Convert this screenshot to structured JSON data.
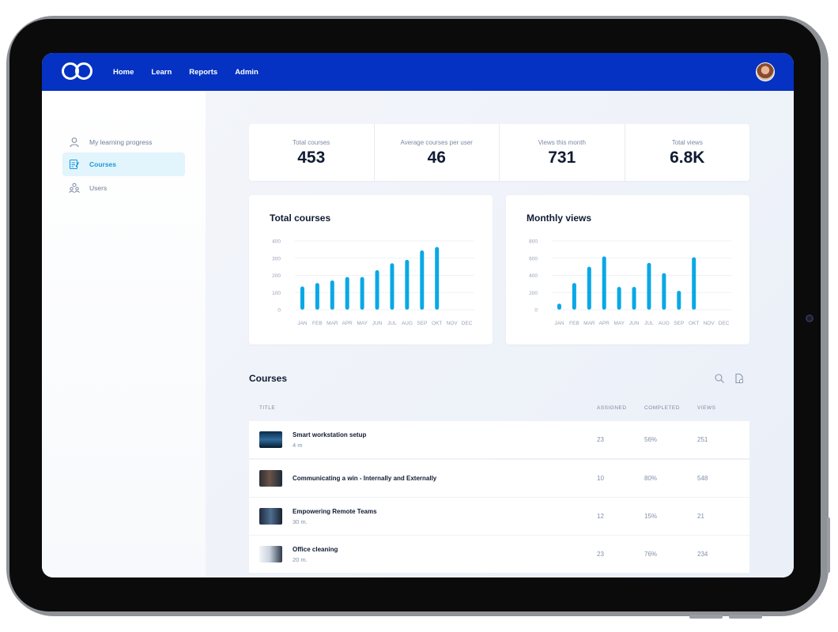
{
  "nav": {
    "items": [
      "Home",
      "Learn",
      "Reports",
      "Admin"
    ]
  },
  "sidebar": {
    "items": [
      {
        "label": "My learning progress",
        "icon": "user-icon",
        "active": false
      },
      {
        "label": "Courses",
        "icon": "course-edit-icon",
        "active": true
      },
      {
        "label": "Users",
        "icon": "users-icon",
        "active": false
      }
    ]
  },
  "stats": [
    {
      "label": "Total courses",
      "value": "453"
    },
    {
      "label": "Average courses per user",
      "value": "46"
    },
    {
      "label": "Views this month",
      "value": "731"
    },
    {
      "label": "Total views",
      "value": "6.8K"
    }
  ],
  "chart_data": [
    {
      "type": "bar",
      "title": "Total courses",
      "categories": [
        "JAN",
        "FEB",
        "MAR",
        "APR",
        "MAY",
        "JUN",
        "JUL",
        "AUG",
        "SEP",
        "OKT",
        "NOV",
        "DEC"
      ],
      "values": [
        135,
        155,
        170,
        190,
        190,
        230,
        270,
        290,
        345,
        365,
        null,
        null
      ],
      "yticks": [
        "0",
        "100",
        "200",
        "300",
        "400"
      ],
      "ylim": [
        0,
        400
      ],
      "color": "#0aa8e6",
      "grid": true
    },
    {
      "type": "bar",
      "title": "Monthly views",
      "categories": [
        "JAN",
        "FEB",
        "MAR",
        "APR",
        "MAY",
        "JUN",
        "JUL",
        "AUG",
        "SEP",
        "OKT",
        "NOV",
        "DEC"
      ],
      "values": [
        70,
        310,
        500,
        620,
        265,
        265,
        545,
        425,
        220,
        610,
        null,
        null
      ],
      "yticks": [
        "0",
        "200",
        "400",
        "600",
        "800"
      ],
      "ylim": [
        0,
        800
      ],
      "color": "#0aa8e6",
      "grid": true
    }
  ],
  "courses": {
    "title": "Courses",
    "columns": {
      "title": "TITLE",
      "assigned": "ASSIGNED",
      "completed": "COMPLETED",
      "views": "VIEWS"
    },
    "rows": [
      {
        "title": "Smart workstation setup",
        "duration": "4 m",
        "assigned": "23",
        "completed": "56%",
        "views": "251"
      },
      {
        "title": "Communicating a win - Internally and Externally",
        "duration": "",
        "assigned": "10",
        "completed": "80%",
        "views": "548"
      },
      {
        "title": "Empowering Remote Teams",
        "duration": "30 m.",
        "assigned": "12",
        "completed": "15%",
        "views": "21"
      },
      {
        "title": "Office cleaning",
        "duration": "20 m.",
        "assigned": "23",
        "completed": "76%",
        "views": "234"
      }
    ]
  }
}
